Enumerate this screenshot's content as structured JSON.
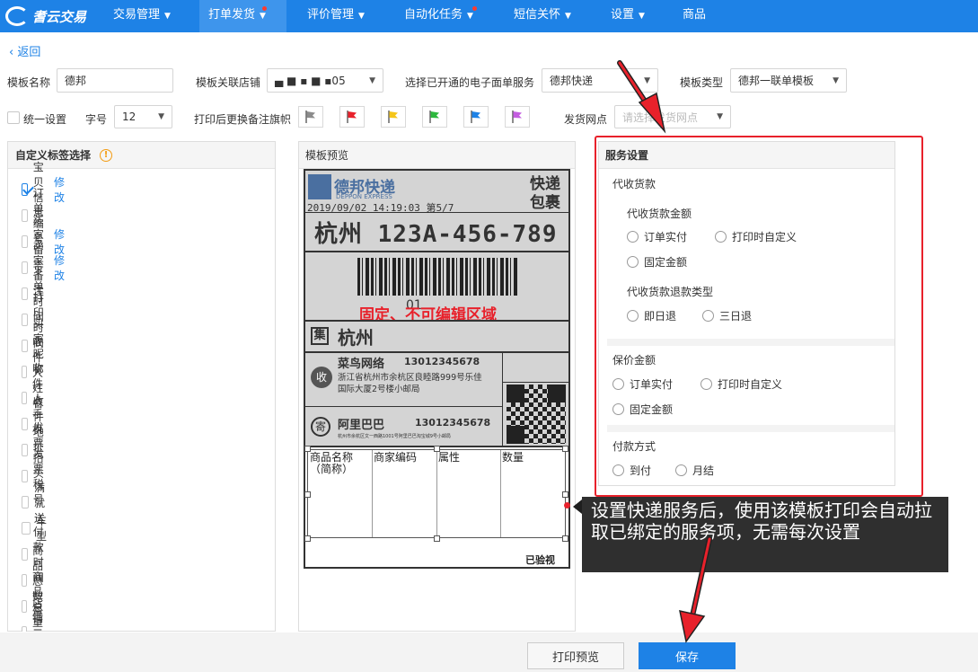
{
  "nav": {
    "logo_text": "耆云交易",
    "items": [
      {
        "label": "交易管理"
      },
      {
        "label": "打单发货"
      },
      {
        "label": "评价管理"
      },
      {
        "label": "自动化任务"
      },
      {
        "label": "短信关怀"
      },
      {
        "label": "设置"
      },
      {
        "label": "商品"
      }
    ]
  },
  "back_label": "返回",
  "form": {
    "template_name_label": "模板名称",
    "template_name_value": "德邦",
    "shop_label": "模板关联店铺",
    "shop_value": "▄  ■   ▪ ■  ▪05",
    "service_label": "选择已开通的电子面单服务",
    "service_value": "德邦快递",
    "type_label": "模板类型",
    "type_value": "德邦一联单模板",
    "unified_label": "统一设置",
    "font_size_label": "字号",
    "font_size_value": "12",
    "flag_label": "打印后更换备注旗帜",
    "ship_point_label": "发货网点",
    "ship_point_placeholder": "请选择发货网点"
  },
  "flag_colors": [
    "#8c8c8c",
    "#e8212b",
    "#f5c518",
    "#2db83d",
    "#1e82e6",
    "#c45ee0"
  ],
  "tags_panel": {
    "title": "自定义标签选择",
    "items": [
      {
        "label": "宝贝信息",
        "edit": "修改"
      },
      {
        "label": "订单编号",
        "edit": ""
      },
      {
        "label": "买家留言",
        "edit": "修改"
      },
      {
        "label": "卖家备注",
        "edit": "修改"
      },
      {
        "label": "下单时间",
        "edit": ""
      },
      {
        "label": "打印时间",
        "edit": ""
      },
      {
        "label": "买家昵称",
        "edit": ""
      },
      {
        "label": "收件人姓名",
        "edit": ""
      },
      {
        "label": "收件人手机",
        "edit": ""
      },
      {
        "label": "收件地址",
        "edit": ""
      },
      {
        "label": "发票抬头",
        "edit": ""
      },
      {
        "label": "发票税号",
        "edit": ""
      },
      {
        "label": "满就送",
        "edit": ""
      },
      {
        "label": "车型",
        "edit": ""
      },
      {
        "label": "付款时间",
        "edit": ""
      },
      {
        "label": "商品总数量",
        "edit": ""
      },
      {
        "label": "商品总重量",
        "edit": ""
      },
      {
        "label": "店铺二维码",
        "edit": ""
      }
    ]
  },
  "preview": {
    "title": "模板预览",
    "brand": "德邦快递",
    "brand_en": "DEPPON EXPRESS",
    "express_line1": "快递",
    "express_line2": "包裹",
    "datetime": "2019/09/02 14:19:03 第5/7",
    "city_code": "杭州  123A-456-789",
    "barcode_digits": "01",
    "fixed_notice": "固定、不可编辑区域",
    "ji_label": "集",
    "ji_city": "杭州",
    "receiver_badge": "收",
    "receiver_name": "菜鸟网络",
    "receiver_phone": "13012345678",
    "receiver_addr1": "浙江省杭州市余杭区良睦路999号乐佳",
    "receiver_addr2": "国际大厦2号楼小邮局",
    "sender_badge": "寄",
    "sender_name": "阿里巴巴",
    "sender_phone": "13012345678",
    "sender_addr": "杭州市余杭区文一西路1001号阿里巴巴淘宝城9号小邮局",
    "goods_headers": [
      "商品名称（简称）",
      "商家编码",
      "属性",
      "数量"
    ],
    "inspected": "已验视"
  },
  "service": {
    "title": "服务设置",
    "cod_label": "代收货款",
    "cod_amount_label": "代收货款金额",
    "cod_amount_options": [
      "订单实付",
      "打印时自定义",
      "固定金额"
    ],
    "cod_refund_label": "代收货款退款类型",
    "cod_refund_options": [
      "即日退",
      "三日退"
    ],
    "insured_label": "保价金额",
    "insured_options": [
      "订单实付",
      "打印时自定义",
      "固定金额"
    ],
    "payment_label": "付款方式",
    "payment_options": [
      "到付",
      "月结"
    ]
  },
  "tooltip": "设置快递服务后，使用该模板打印会自动拉取已绑定的服务项，无需每次设置",
  "buttons": {
    "print_preview": "打印预览",
    "save": "保存"
  },
  "colors": {
    "brand_blue": "#1e82e6",
    "highlight_red": "#e8212b"
  }
}
